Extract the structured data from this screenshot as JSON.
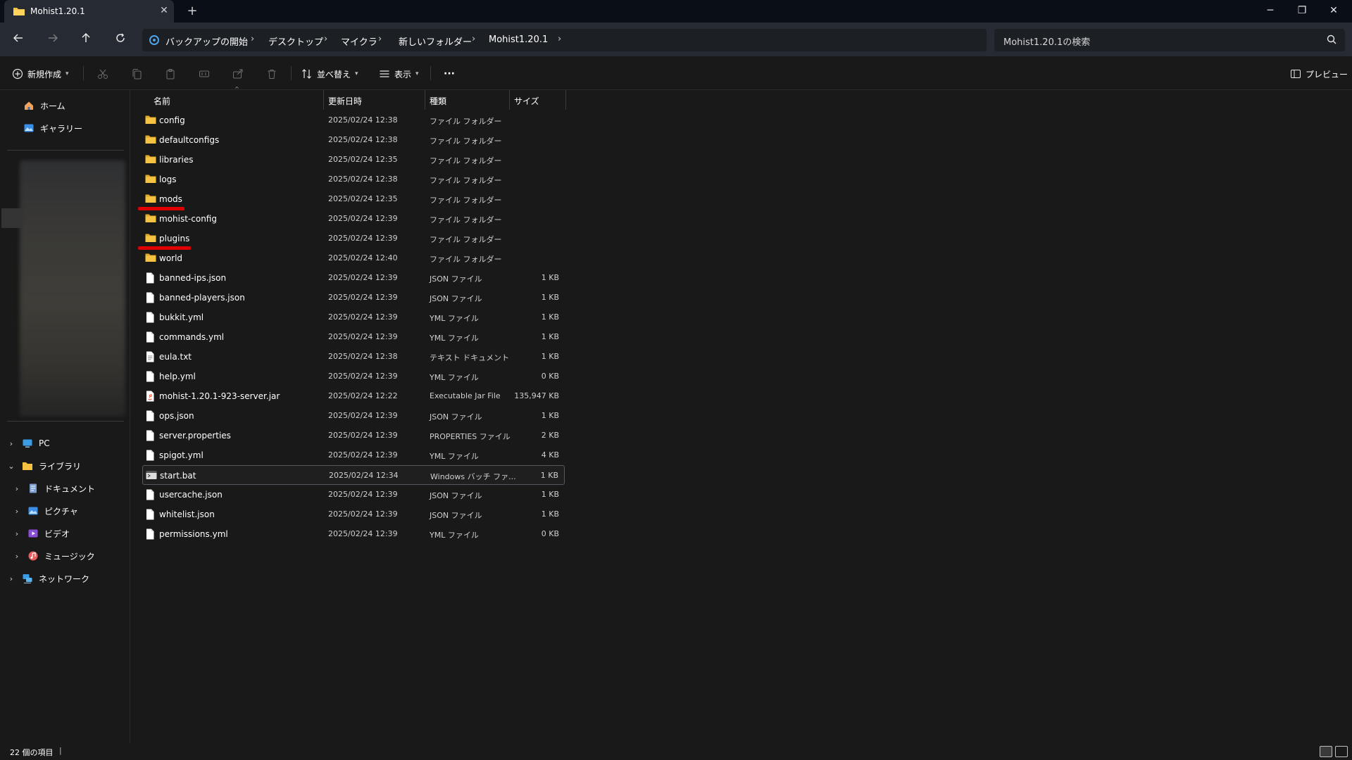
{
  "tab": {
    "title": "Mohist1.20.1",
    "new_tab": "+"
  },
  "window": {
    "minimize": "─",
    "maximize": "❐",
    "close": "✕"
  },
  "address": {
    "crumbs": [
      "バックアップの開始",
      "デスクトップ",
      "マイクラ",
      "新しいフォルダー",
      "Mohist1.20.1"
    ],
    "separator": "›"
  },
  "search": {
    "placeholder": "Mohist1.20.1の検索"
  },
  "toolbar": {
    "new_label": "新規作成",
    "sort_label": "並べ替え",
    "view_label": "表示",
    "more_label": "···",
    "preview_label": "プレビュー"
  },
  "sidebar": {
    "home": "ホーム",
    "gallery": "ギャラリー",
    "pc": "PC",
    "library": "ライブラリ",
    "documents": "ドキュメント",
    "pictures": "ピクチャ",
    "videos": "ビデオ",
    "music": "ミュージック",
    "network": "ネットワーク"
  },
  "columns": {
    "name": "名前",
    "date": "更新日時",
    "type": "種類",
    "size": "サイズ"
  },
  "files": [
    {
      "name": "config",
      "date": "2025/02/24 12:38",
      "type": "ファイル フォルダー",
      "size": "",
      "kind": "folder"
    },
    {
      "name": "defaultconfigs",
      "date": "2025/02/24 12:38",
      "type": "ファイル フォルダー",
      "size": "",
      "kind": "folder"
    },
    {
      "name": "libraries",
      "date": "2025/02/24 12:35",
      "type": "ファイル フォルダー",
      "size": "",
      "kind": "folder"
    },
    {
      "name": "logs",
      "date": "2025/02/24 12:38",
      "type": "ファイル フォルダー",
      "size": "",
      "kind": "folder"
    },
    {
      "name": "mods",
      "date": "2025/02/24 12:35",
      "type": "ファイル フォルダー",
      "size": "",
      "kind": "folder"
    },
    {
      "name": "mohist-config",
      "date": "2025/02/24 12:39",
      "type": "ファイル フォルダー",
      "size": "",
      "kind": "folder"
    },
    {
      "name": "plugins",
      "date": "2025/02/24 12:39",
      "type": "ファイル フォルダー",
      "size": "",
      "kind": "folder"
    },
    {
      "name": "world",
      "date": "2025/02/24 12:40",
      "type": "ファイル フォルダー",
      "size": "",
      "kind": "folder"
    },
    {
      "name": "banned-ips.json",
      "date": "2025/02/24 12:39",
      "type": "JSON ファイル",
      "size": "1 KB",
      "kind": "file"
    },
    {
      "name": "banned-players.json",
      "date": "2025/02/24 12:39",
      "type": "JSON ファイル",
      "size": "1 KB",
      "kind": "file"
    },
    {
      "name": "bukkit.yml",
      "date": "2025/02/24 12:39",
      "type": "YML ファイル",
      "size": "1 KB",
      "kind": "file"
    },
    {
      "name": "commands.yml",
      "date": "2025/02/24 12:39",
      "type": "YML ファイル",
      "size": "1 KB",
      "kind": "file"
    },
    {
      "name": "eula.txt",
      "date": "2025/02/24 12:38",
      "type": "テキスト ドキュメント",
      "size": "1 KB",
      "kind": "text"
    },
    {
      "name": "help.yml",
      "date": "2025/02/24 12:39",
      "type": "YML ファイル",
      "size": "0 KB",
      "kind": "file"
    },
    {
      "name": "mohist-1.20.1-923-server.jar",
      "date": "2025/02/24 12:22",
      "type": "Executable Jar File",
      "size": "135,947 KB",
      "kind": "jar"
    },
    {
      "name": "ops.json",
      "date": "2025/02/24 12:39",
      "type": "JSON ファイル",
      "size": "1 KB",
      "kind": "file"
    },
    {
      "name": "server.properties",
      "date": "2025/02/24 12:39",
      "type": "PROPERTIES ファイル",
      "size": "2 KB",
      "kind": "file"
    },
    {
      "name": "spigot.yml",
      "date": "2025/02/24 12:39",
      "type": "YML ファイル",
      "size": "4 KB",
      "kind": "file"
    },
    {
      "name": "start.bat",
      "date": "2025/02/24 12:34",
      "type": "Windows バッチ ファ...",
      "size": "1 KB",
      "kind": "bat"
    },
    {
      "name": "usercache.json",
      "date": "2025/02/24 12:39",
      "type": "JSON ファイル",
      "size": "1 KB",
      "kind": "file"
    },
    {
      "name": "whitelist.json",
      "date": "2025/02/24 12:39",
      "type": "JSON ファイル",
      "size": "1 KB",
      "kind": "file"
    },
    {
      "name": "permissions.yml",
      "date": "2025/02/24 12:39",
      "type": "YML ファイル",
      "size": "0 KB",
      "kind": "file"
    }
  ],
  "selected_index": 18,
  "highlighted": [
    "mods",
    "plugins"
  ],
  "status": {
    "count": "22 個の項目",
    "divider": "|"
  },
  "colors": {
    "folder": "#f5c242",
    "highlight": "#e00000",
    "accent": "#4fa3e8"
  }
}
